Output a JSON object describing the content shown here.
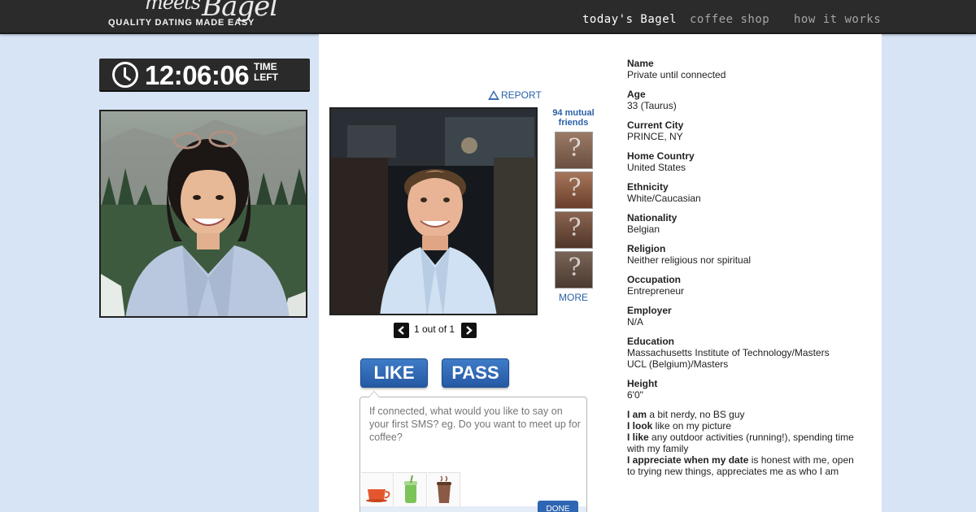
{
  "header": {
    "logo_meets": "meets",
    "logo_bagel": "Bagel",
    "tagline": "QUALITY DATING MADE EASY",
    "nav": [
      {
        "label": "today's Bagel",
        "active": true
      },
      {
        "label": "coffee shop",
        "active": false
      },
      {
        "label": "how it works",
        "active": false
      }
    ]
  },
  "timer": {
    "value": "12:06:06",
    "label": "TIME LEFT"
  },
  "report_label": "REPORT",
  "mutual_friends": {
    "label": "94 mutual friends",
    "more": "MORE"
  },
  "pager": {
    "text": "1 out of 1"
  },
  "actions": {
    "like": "LIKE",
    "pass": "PASS"
  },
  "message": {
    "placeholder": "If connected, what would you like to say on your first SMS? eg. Do you want to meet up for coffee?",
    "done": "DONE",
    "drinks": [
      "coffee-cup-icon",
      "iced-drink-icon",
      "hot-chocolate-icon"
    ]
  },
  "profile": {
    "fields": [
      {
        "label": "Name",
        "value": "Private until connected"
      },
      {
        "label": "Age",
        "value": "33 (Taurus)"
      },
      {
        "label": "Current City",
        "value": "PRINCE, NY"
      },
      {
        "label": "Home Country",
        "value": "United States"
      },
      {
        "label": "Ethnicity",
        "value": "White/Caucasian"
      },
      {
        "label": "Nationality",
        "value": "Belgian"
      },
      {
        "label": "Religion",
        "value": "Neither religious nor spiritual"
      },
      {
        "label": "Occupation",
        "value": "Entrepreneur"
      },
      {
        "label": "Employer",
        "value": "N/A"
      },
      {
        "label": "Education",
        "value": "Massachusetts Institute of Technology/Masters",
        "value2": "UCL (Belgium)/Masters"
      },
      {
        "label": "Height",
        "value": "6'0\""
      }
    ],
    "about": [
      {
        "lead": "I am",
        "text": " a bit nerdy, no BS guy"
      },
      {
        "lead": "I look",
        "text": " like on my picture"
      },
      {
        "lead": "I like",
        "text": " any outdoor activities (running!), spending time with my family"
      },
      {
        "lead": "I appreciate when my date",
        "text": " is honest with me, open to trying new things, appreciates me as who I am"
      }
    ]
  },
  "colors": {
    "header_bg": "#2b2b2b",
    "page_bg": "#d7e4f6",
    "accent_blue": "#2f66b3",
    "link_blue": "#2a61a8"
  }
}
